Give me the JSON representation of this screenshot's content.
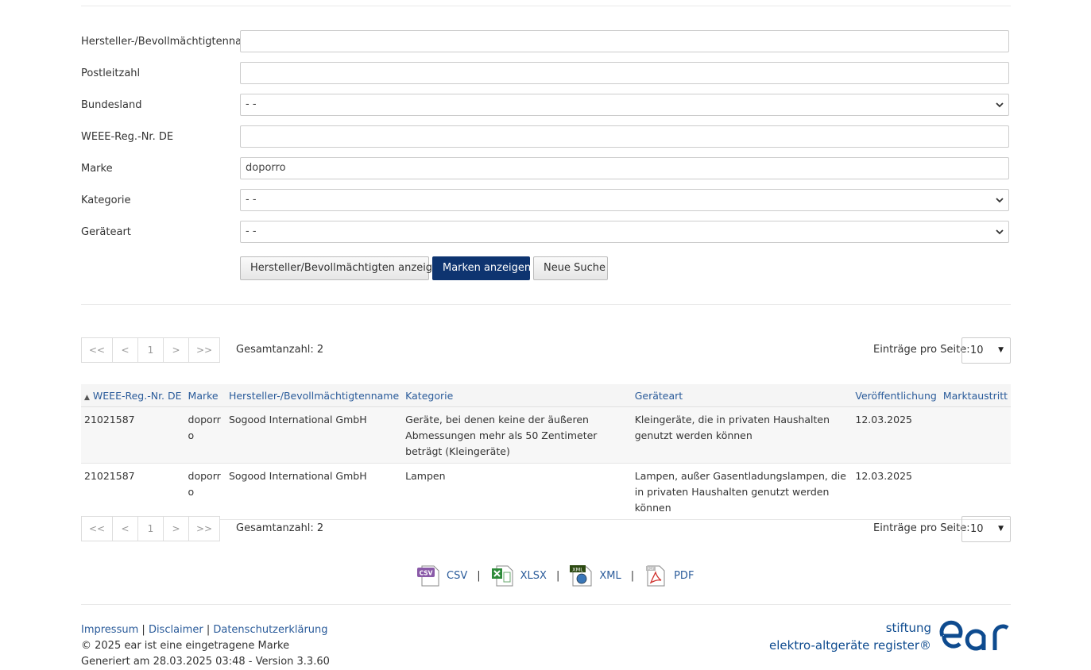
{
  "form": {
    "fields": [
      {
        "label": "Hersteller-/Bevollmächtigtenname",
        "value": "",
        "type": "text"
      },
      {
        "label": "Postleitzahl",
        "value": "",
        "type": "text"
      },
      {
        "label": "Bundesland",
        "value": "- -",
        "type": "select"
      },
      {
        "label": "WEEE-Reg.-Nr. DE",
        "value": "",
        "type": "text"
      },
      {
        "label": "Marke",
        "value": "doporro",
        "type": "text"
      },
      {
        "label": "Kategorie",
        "value": "- -",
        "type": "select"
      },
      {
        "label": "Geräteart",
        "value": "- -",
        "type": "select"
      }
    ],
    "buttons": {
      "show_manufacturers": "Hersteller/Bevollmächtigten anzeigen",
      "show_brands": "Marken anzeigen",
      "new_search": "Neue Suche"
    }
  },
  "pager": {
    "first": "<<",
    "prev": "<",
    "page": "1",
    "next": ">",
    "last": ">>",
    "total_label": "Gesamtanzahl: 2",
    "per_page_label": "Einträge pro Seite:",
    "per_page_value": "10"
  },
  "table": {
    "sort_indicator": "▲",
    "headers": [
      "WEEE-Reg.-Nr. DE",
      "Marke",
      "Hersteller-/Bevollmächtigtenname",
      "Kategorie",
      "Geräteart",
      "Veröffentlichung",
      "Marktaustritt"
    ],
    "rows": [
      [
        "21021587",
        "doporr o",
        "Sogood International GmbH",
        "Geräte, bei denen keine der äußeren Abmessungen mehr als 50 Zentimeter beträgt (Kleingeräte)",
        "Kleingeräte, die in privaten Haushalten genutzt werden können",
        "12.03.2025",
        ""
      ],
      [
        "21021587",
        "doporr o",
        "Sogood International GmbH",
        "Lampen",
        "Lampen, außer Gasentladungslampen, die in privaten Haushalten genutzt werden können",
        "12.03.2025",
        ""
      ]
    ]
  },
  "exports": {
    "csv": "CSV",
    "xlsx": "XLSX",
    "xml": "XML",
    "pdf": "PDF",
    "csv_icon_text": "CSV",
    "xml_icon_text": "XML",
    "pdf_icon_text": "PDF",
    "separator": "|"
  },
  "footer": {
    "impressum": "Impressum",
    "disclaimer": "Disclaimer",
    "privacy": "Datenschutzerklärung",
    "link_separator": "|",
    "copyright": "© 2025 ear ist eine eingetragene Marke",
    "generated": "Generiert am 28.03.2025 03:48 - Version 3.3.60"
  },
  "brand": {
    "line1": "stiftung",
    "line2": "elektro-altgeräte register®",
    "logo_text": "ear",
    "color": "#0e4b8f"
  },
  "colors": {
    "primary_button": "#0e3470",
    "link": "#2a5b9a"
  }
}
